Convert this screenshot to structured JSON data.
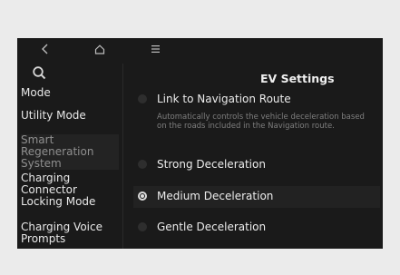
{
  "topbar": {
    "back_icon": "chevron-left-icon",
    "home_icon": "home-icon",
    "menu_icon": "menu-icon"
  },
  "sidebar": {
    "search_icon": "search-icon",
    "items": [
      {
        "lines": [
          "Mode"
        ]
      },
      {
        "lines": [
          "Utility Mode"
        ]
      },
      {
        "lines": [
          "Smart",
          "Regeneration",
          "System"
        ]
      },
      {
        "lines": [
          "Charging",
          "Connector",
          "Locking Mode"
        ]
      },
      {
        "lines": [
          "Charging Voice",
          "Prompts"
        ]
      }
    ]
  },
  "main": {
    "title": "EV Settings",
    "options": [
      {
        "label": "Link to Navigation Route",
        "description": "Automatically controls the vehicle deceleration based on the roads included in the Navigation route.",
        "checked": false
      },
      {
        "label": "Strong Deceleration",
        "checked": false
      },
      {
        "label": "Medium Deceleration",
        "checked": true
      },
      {
        "label": "Gentle Deceleration",
        "checked": false
      }
    ]
  },
  "colors": {
    "screen_bg": "#1a1a1a",
    "page_bg": "#ebebeb",
    "muted_text": "#8f8f8f"
  }
}
